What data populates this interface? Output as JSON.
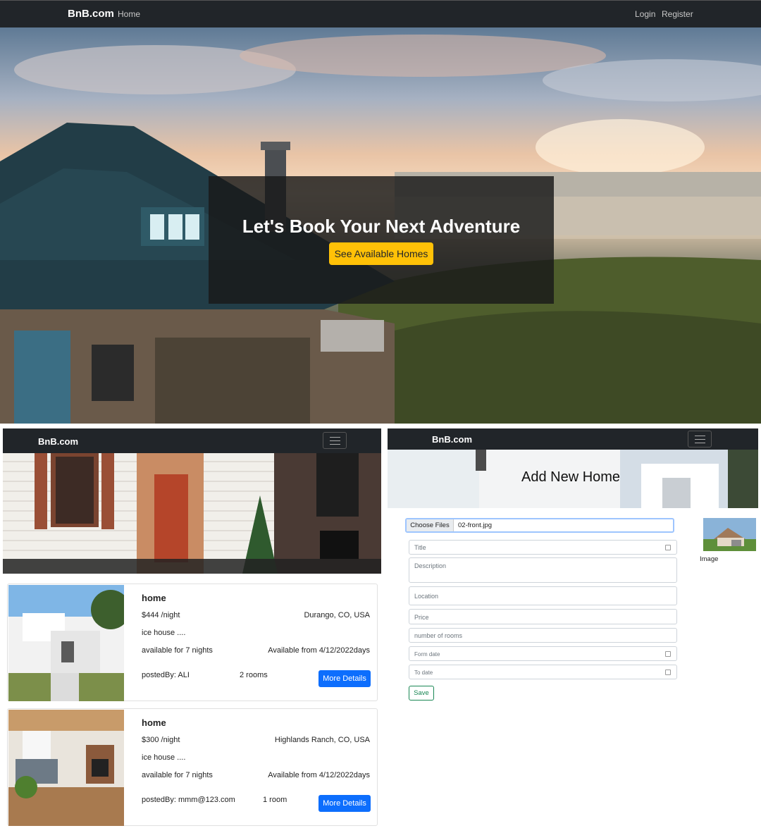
{
  "top_nav": {
    "brand": "BnB.com",
    "home": "Home",
    "login": "Login",
    "register": "Register"
  },
  "hero": {
    "title": "Let's Book Your Next Adventure",
    "cta": "See Available Homes"
  },
  "listing_view": {
    "nav_brand": "BnB.com",
    "cards": [
      {
        "title": "home",
        "price": "$444 /night",
        "location": "Durango, CO, USA",
        "description": "ice house ....",
        "nights": "available for 7 nights",
        "available": "Available from 4/12/2022days",
        "posted_by": "postedBy: ALI",
        "rooms": "2 rooms",
        "button": "More Details"
      },
      {
        "title": "home",
        "price": "$300 /night",
        "location": "Highlands Ranch, CO, USA",
        "description": "ice house ....",
        "nights": "available for 7 nights",
        "available": "Available from 4/12/2022days",
        "posted_by": "postedBy: mmm@123.com",
        "rooms": "1 room",
        "button": "More Details"
      }
    ]
  },
  "add_view": {
    "nav_brand": "BnB.com",
    "heading": "Add New Home",
    "file_button": "Choose Files",
    "file_name": "02-front.jpg",
    "fields": {
      "title": "Title",
      "description": "Description",
      "location": "Location",
      "price": "Price",
      "rooms": "number of rooms",
      "from": "Form date",
      "to": "To date"
    },
    "save": "Save",
    "preview_label": "Image"
  },
  "colors": {
    "navbar": "#212529",
    "cta": "#ffc107",
    "primary": "#0d6efd",
    "success": "#198754"
  }
}
